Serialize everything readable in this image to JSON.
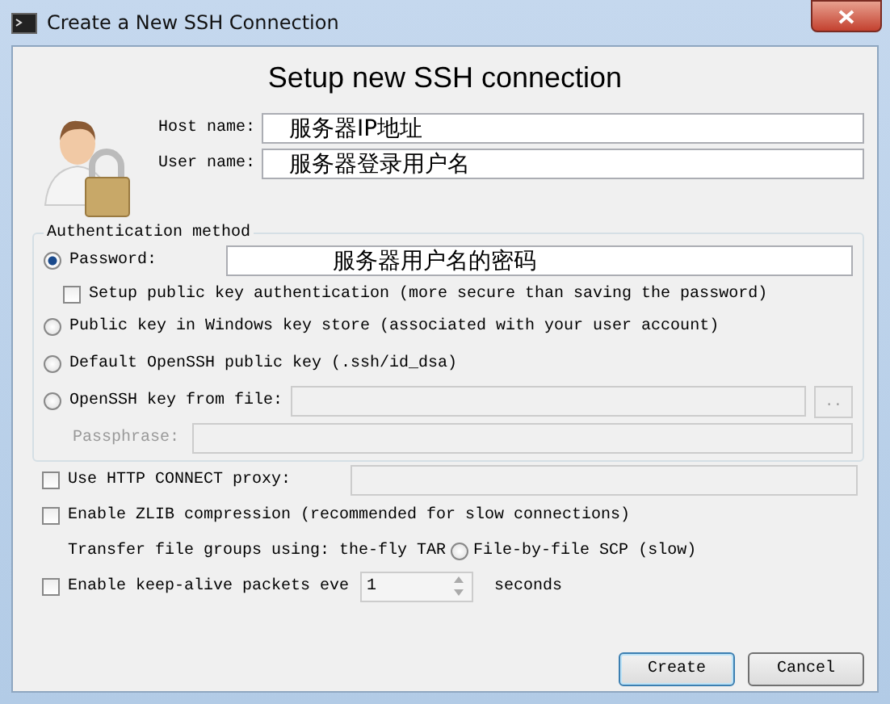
{
  "window": {
    "title": "Create a New SSH Connection"
  },
  "heading": "Setup new SSH connection",
  "fields": [
    {
      "label": "Host name:",
      "value": "服务器IP地址"
    },
    {
      "label": "User name:",
      "value": "服务器登录用户名"
    }
  ],
  "auth": {
    "legend": "Authentication method",
    "options": [
      {
        "kind": "radio",
        "label": "Password:",
        "selected": true,
        "field_value": "服务器用户名的密码"
      },
      {
        "kind": "checkbox",
        "label": "Setup public key authentication (more secure than saving the password)",
        "checked": false
      },
      {
        "kind": "radio",
        "label": "Public key in Windows key store (associated with your user account)",
        "selected": false
      },
      {
        "kind": "radio",
        "label": "Default OpenSSH public key (.ssh/id_dsa)",
        "selected": false
      },
      {
        "kind": "radio",
        "label": "OpenSSH key from file:",
        "selected": false,
        "browse": ".."
      },
      {
        "kind": "passphrase",
        "label": "Passphrase:",
        "disabled": true
      }
    ]
  },
  "options": [
    {
      "kind": "checkbox",
      "label": "Use HTTP CONNECT proxy:",
      "checked": false,
      "has_field": true
    },
    {
      "kind": "checkbox",
      "label": "Enable ZLIB compression (recommended for slow connections)",
      "checked": false
    },
    {
      "kind": "transfer",
      "label": "Transfer file groups using: the-fly TAR",
      "radio_label": "File-by-file SCP (slow)",
      "selected": false
    },
    {
      "kind": "keepalive",
      "label": "Enable keep-alive packets eve",
      "checked": false,
      "value": "1",
      "unit": "seconds"
    }
  ],
  "buttons": [
    {
      "label": "Create",
      "default": true
    },
    {
      "label": "Cancel",
      "default": false
    }
  ]
}
